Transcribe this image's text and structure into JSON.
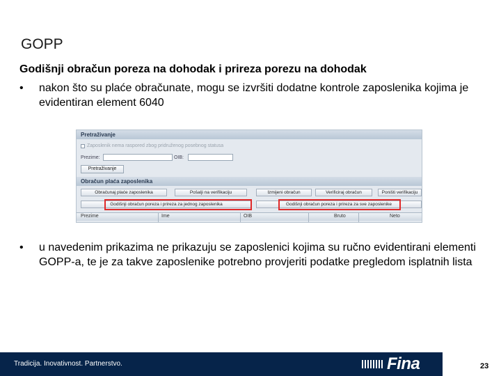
{
  "slide": {
    "title": "GOPP",
    "subtitle": "Godišnji obračun poreza na dohodak i prireza porezu na dohodak",
    "bullet_char": "•",
    "bullets": [
      "nakon što su plaće obračunate, mogu se izvršiti dodatne kontrole zaposlenika kojima je evidentiran element 6040",
      "u navedenim prikazima ne prikazuju se zaposlenici kojima su ručno evidentirani elementi GOPP-a, te je za takve zaposlenike potrebno provjeriti podatke pregledom isplatnih lista"
    ],
    "footer_text": "Tradicija. Inovativnost. Partnerstvo.",
    "logo_text": "Fina",
    "page_number": "23"
  },
  "screenshot": {
    "search_header": "Pretraživanje",
    "checkbox_label": "Zaposlenik nema raspored zbog pridruženog posebnog statusa",
    "surname_label": "Prezime:",
    "oib_label": "OIB:",
    "search_button": "Pretraživanje",
    "payroll_header": "Obračun plaća zaposlenika",
    "buttons_row1": [
      "Obračunaj plaće zaposlenika",
      "Pošalji na verifikaciju",
      "Izmijeni obračun",
      "Verificiraj obračun",
      "Poništi verifikaciju"
    ],
    "buttons_row2": [
      "Godišnji obračun poreza i prireza za jednog zaposlenika",
      "Godišnji obračun poreza i prireza za sve zaposlenike"
    ],
    "columns": [
      "Prezime",
      "Ime",
      "OIB",
      "Bruto",
      "Neto"
    ],
    "highlight_color": "#e02a2a"
  }
}
